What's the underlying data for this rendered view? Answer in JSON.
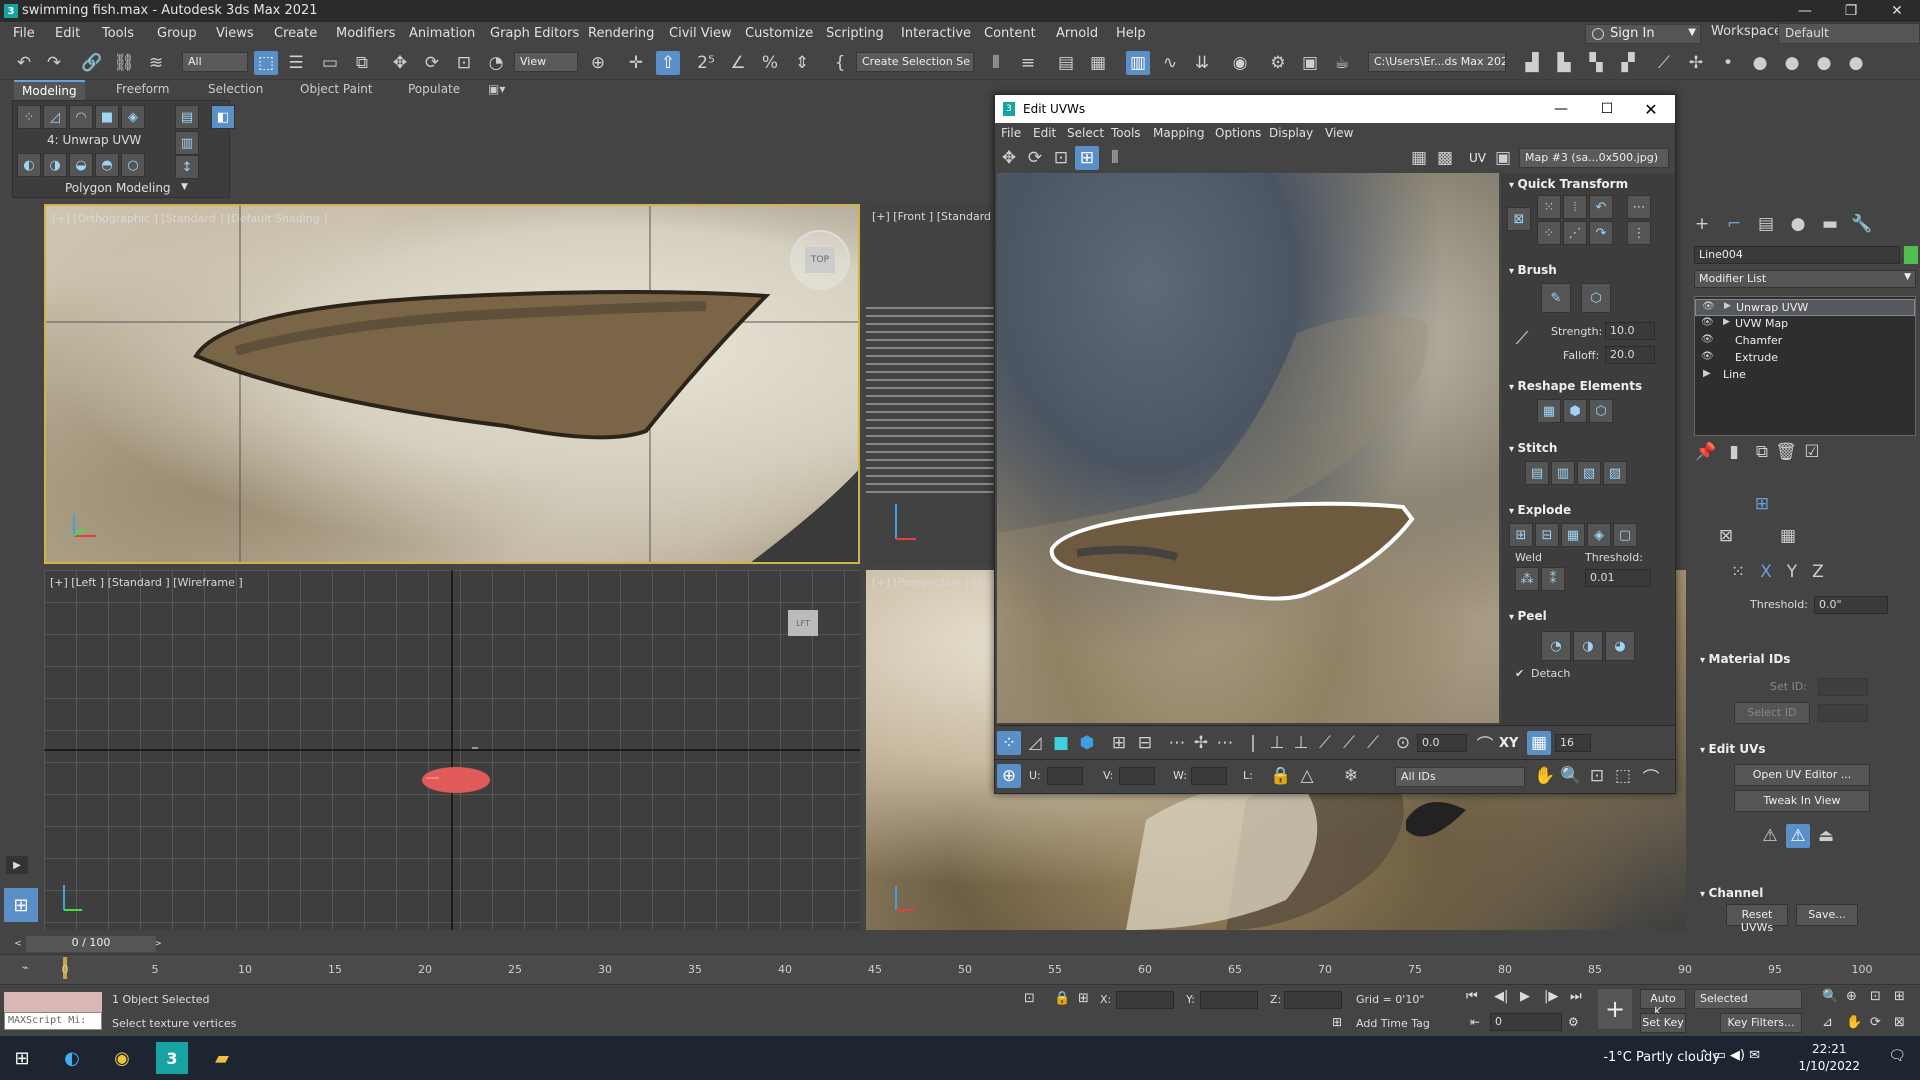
{
  "titlebar": {
    "title": "swimming fish.max - Autodesk 3ds Max 2021",
    "app_icon": "3"
  },
  "menubar": {
    "items": [
      "File",
      "Edit",
      "Tools",
      "Group",
      "Views",
      "Create",
      "Modifiers",
      "Animation",
      "Graph Editors",
      "Rendering",
      "Civil View",
      "Customize",
      "Scripting",
      "Interactive",
      "Content",
      "Arnold",
      "Help"
    ],
    "sign_in": "Sign In",
    "workspaces_label": "Workspaces:",
    "workspace_value": "Default"
  },
  "toolbar": {
    "selection_filter": "All",
    "ref_coord": "View",
    "selection_set": "Create Selection Se",
    "project_path": "C:\\Users\\Er...ds Max 202"
  },
  "ribbon": {
    "tabs": [
      "Modeling",
      "Freeform",
      "Selection",
      "Object Paint",
      "Populate"
    ],
    "modifier_label": "4: Unwrap UVW",
    "panel_label": "Polygon Modeling"
  },
  "viewports": {
    "topleft_label": "[+] [Orthographic ] [Standard ] [Default Shading ]",
    "front_label": "[+] [Front ] [Standard ]",
    "left_label": "[+] [Left ] [Standard ] [Wireframe ]",
    "persp_label": "[+] [Perspective ] [Stan",
    "viewcube_top": "TOP",
    "viewcube_left": "LFT"
  },
  "uvw": {
    "title": "Edit UVWs",
    "menu": [
      "File",
      "Edit",
      "Select",
      "Tools",
      "Mapping",
      "Options",
      "Display",
      "View"
    ],
    "uv_label": "UV",
    "map_select": "Map #3 (sa...0x500.jpg)",
    "rollouts": {
      "quick_transform": "Quick Transform",
      "brush": "Brush",
      "strength_label": "Strength:",
      "strength_value": "10.0",
      "falloff_label": "Falloff:",
      "falloff_value": "20.0",
      "reshape": "Reshape Elements",
      "stitch": "Stitch",
      "explode": "Explode",
      "weld": "Weld",
      "threshold_label": "Threshold:",
      "threshold_value": "0.01",
      "peel": "Peel",
      "detach": "Detach"
    },
    "bottom": {
      "spinner_value": "0.0",
      "xy_label": "XY",
      "grid_value": "16",
      "u_label": "U:",
      "v_label": "V:",
      "w_label": "W:",
      "l_label": "L:",
      "ids_select": "All IDs"
    }
  },
  "cmdpanel": {
    "object_name": "Line004",
    "modifier_list": "Modifier List",
    "stack": [
      "Unwrap UVW",
      "UVW Map",
      "Chamfer",
      "Extrude",
      "Line"
    ],
    "threshold_label": "Threshold:",
    "threshold_value": "0.0\"",
    "material_ids": "Material IDs",
    "set_id": "Set ID:",
    "select_id": "Select ID",
    "edit_uvs": "Edit UVs",
    "open_uv_editor": "Open UV Editor ...",
    "tweak_in_view": "Tweak In View",
    "channel": "Channel",
    "reset_uvws": "Reset UVWs",
    "save": "Save..."
  },
  "timeline": {
    "frame_indicator": "0 / 100",
    "ticks": [
      "0",
      "5",
      "10",
      "15",
      "20",
      "25",
      "30",
      "35",
      "40",
      "45",
      "50",
      "55",
      "60",
      "65",
      "70",
      "75",
      "80",
      "85",
      "90",
      "95",
      "100"
    ]
  },
  "status": {
    "maxscript": "MAXScript Mi:",
    "selected": "1 Object Selected",
    "prompt": "Select texture vertices",
    "x_label": "X:",
    "y_label": "Y:",
    "z_label": "Z:",
    "grid": "Grid = 0'10\"",
    "add_time_tag": "Add Time Tag",
    "auto_key": "Auto K...",
    "set_key": "Set Key",
    "selected_dd": "Selected",
    "key_filters": "Key Filters...",
    "frame_value": "0"
  },
  "taskbar": {
    "weather": "-1°C  Partly cloudy",
    "time": "22:21",
    "date": "1/10/2022"
  }
}
